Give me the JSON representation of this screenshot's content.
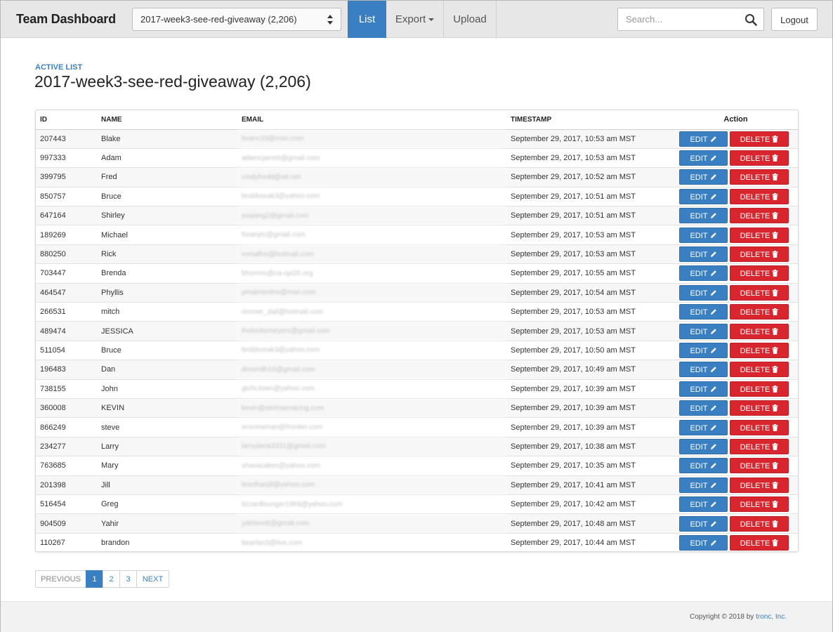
{
  "navbar": {
    "brand": "Team Dashboard",
    "list_select_value": "2017-week3-see-red-giveaway (2,206)",
    "tabs": {
      "list": "List",
      "export": "Export",
      "upload": "Upload"
    },
    "search_placeholder": "Search...",
    "logout": "Logout",
    "active_color": "#3a7fc1"
  },
  "header": {
    "eyebrow": "ACTIVE LIST",
    "title": "2017-week3-see-red-giveaway (2,206)"
  },
  "table": {
    "columns": {
      "id": "ID",
      "name": "NAME",
      "email": "EMAIL",
      "timestamp": "TIMESTAMP",
      "action": "Action"
    },
    "edit_label": "EDIT",
    "delete_label": "DELETE",
    "edit_color": "#3a7fc1",
    "delete_color": "#d9262e",
    "rows": [
      {
        "id": "207443",
        "name": "Blake",
        "email": "bvanc33@msn.com",
        "timestamp": "September 29, 2017, 10:53 am MST"
      },
      {
        "id": "997333",
        "name": "Adam",
        "email": "adamcjarrett@gmail.com",
        "timestamp": "September 29, 2017, 10:53 am MST"
      },
      {
        "id": "399795",
        "name": "Fred",
        "email": "cindyfredd@att.net",
        "timestamp": "September 29, 2017, 10:52 am MST"
      },
      {
        "id": "850757",
        "name": "Bruce",
        "email": "bnddvorak3@yahoo.com",
        "timestamp": "September 29, 2017, 10:51 am MST"
      },
      {
        "id": "647164",
        "name": "Shirley",
        "email": "ssqiang2@gmail.com",
        "timestamp": "September 29, 2017, 10:51 am MST"
      },
      {
        "id": "189269",
        "name": "Michael",
        "email": "foranylc@gmail.com",
        "timestamp": "September 29, 2017, 10:53 am MST"
      },
      {
        "id": "880250",
        "name": "Rick",
        "email": "metalfrei@hotmail.com",
        "timestamp": "September 29, 2017, 10:53 am MST"
      },
      {
        "id": "703447",
        "name": "Brenda",
        "email": "bhornns@ca-cpi20.org",
        "timestamp": "September 29, 2017, 10:55 am MST"
      },
      {
        "id": "464547",
        "name": "Phyllis",
        "email": "pmaimentno@msn.com",
        "timestamp": "September 29, 2017, 10:54 am MST"
      },
      {
        "id": "266531",
        "name": "mitch",
        "email": "rimmer_dail@hotmail.com",
        "timestamp": "September 29, 2017, 10:53 am MST"
      },
      {
        "id": "489474",
        "name": "JESSICA",
        "email": "thelockemeyers@gmail.com",
        "timestamp": "September 29, 2017, 10:53 am MST"
      },
      {
        "id": "511054",
        "name": "Bruce",
        "email": "bnddvorak3@yahoo.com",
        "timestamp": "September 29, 2017, 10:50 am MST"
      },
      {
        "id": "196483",
        "name": "Dan",
        "email": "dmsmith16@gmail.com",
        "timestamp": "September 29, 2017, 10:49 am MST"
      },
      {
        "id": "738155",
        "name": "John",
        "email": "gtchi.town@yahoo.com",
        "timestamp": "September 29, 2017, 10:39 am MST"
      },
      {
        "id": "360008",
        "name": "KEVIN",
        "email": "kevin@stelmanracing.com",
        "timestamp": "September 29, 2017, 10:39 am MST"
      },
      {
        "id": "866249",
        "name": "steve",
        "email": "scsnewman@frontier.com",
        "timestamp": "September 29, 2017, 10:39 am MST"
      },
      {
        "id": "234277",
        "name": "Larry",
        "email": "larrydana3331@gmail.com",
        "timestamp": "September 29, 2017, 10:38 am MST"
      },
      {
        "id": "763685",
        "name": "Mary",
        "email": "shavacakes@yahoo.com",
        "timestamp": "September 29, 2017, 10:35 am MST"
      },
      {
        "id": "201398",
        "name": "Jill",
        "email": "tesslhanj8@yahoo.com",
        "timestamp": "September 29, 2017, 10:41 am MST"
      },
      {
        "id": "516454",
        "name": "Greg",
        "email": "lizzardlounger1969@yahoo.com",
        "timestamp": "September 29, 2017, 10:42 am MST"
      },
      {
        "id": "904509",
        "name": "Yahir",
        "email": "ydeleon6@gmail.com",
        "timestamp": "September 29, 2017, 10:48 am MST"
      },
      {
        "id": "110267",
        "name": "brandon",
        "email": "bearfan3@live.com",
        "timestamp": "September 29, 2017, 10:44 am MST"
      }
    ]
  },
  "pagination": {
    "previous": "PREVIOUS",
    "pages": [
      "1",
      "2",
      "3"
    ],
    "current": "1",
    "next": "NEXT"
  },
  "footer": {
    "copyright": "Copyright © 2018 by ",
    "company": "tronc, Inc."
  }
}
